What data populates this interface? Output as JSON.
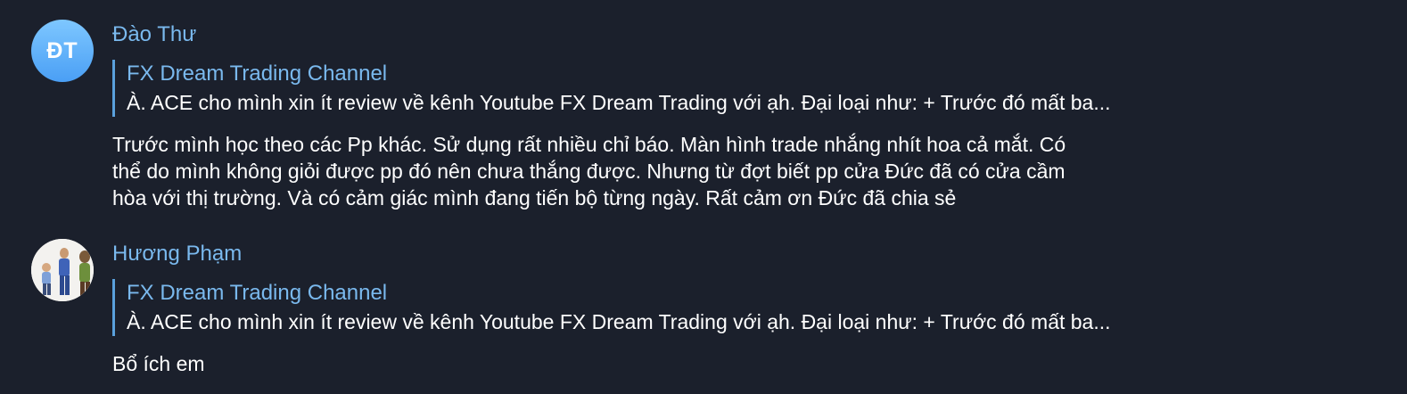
{
  "messages": [
    {
      "avatar_initials": "ĐT",
      "sender": "Đào Thư",
      "reply": {
        "title": "FX Dream Trading Channel",
        "text": "À. ACE cho mình xin ít review về kênh Youtube FX Dream Trading với ạh.  Đại loại như:  + Trước đó mất ba..."
      },
      "text": "Trước mình học theo các Pp khác. Sử dụng rất nhiều chỉ báo. Màn hình trade nhắng nhít hoa cả mắt. Có thể do mình không giỏi được pp đó nên chưa thắng được. Nhưng từ đợt biết pp cửa Đức đã có cửa cầm hòa với thị trường. Và có cảm giác mình đang tiến bộ từng ngày. Rất cảm ơn Đức đã chia sẻ"
    },
    {
      "sender": "Hương Phạm",
      "reply": {
        "title": "FX Dream Trading Channel",
        "text": "À. ACE cho mình xin ít review về kênh Youtube FX Dream Trading với ạh.  Đại loại như:  + Trước đó mất ba..."
      },
      "text": "Bổ ích em"
    }
  ],
  "colors": {
    "background": "#1b202c",
    "sender_name": "#7ab9ee",
    "reply_bar": "#5aa0dc",
    "text": "#ffffff",
    "avatar_gradient_top": "#7ec7ff",
    "avatar_gradient_bottom": "#4a9ff5"
  },
  "icons": {
    "avatar_2": "family-photo-avatar"
  }
}
